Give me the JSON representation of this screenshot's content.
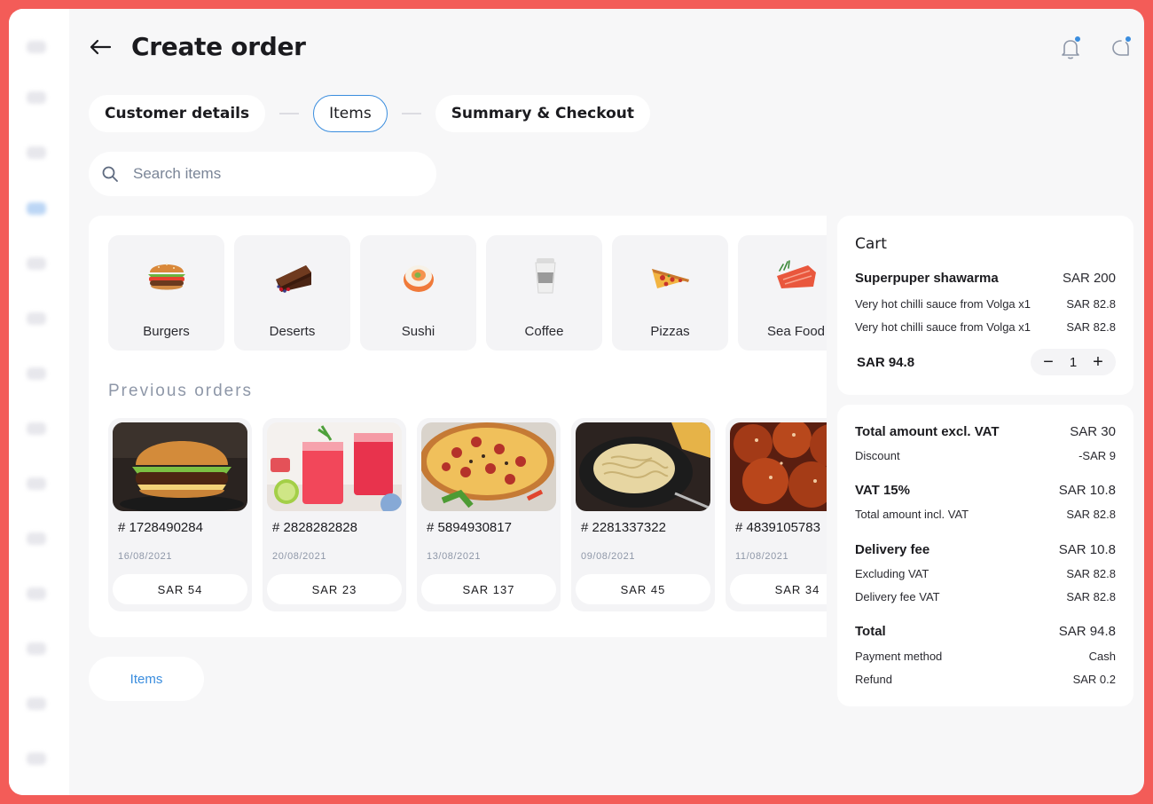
{
  "header": {
    "title": "Create order"
  },
  "steps": [
    {
      "label": "Customer details"
    },
    {
      "label": "Items"
    },
    {
      "label": "Summary & Checkout"
    }
  ],
  "search": {
    "placeholder": "Search items"
  },
  "categories": [
    {
      "label": "Burgers"
    },
    {
      "label": "Deserts"
    },
    {
      "label": "Sushi"
    },
    {
      "label": "Coffee"
    },
    {
      "label": "Pizzas"
    },
    {
      "label": "Sea Food"
    }
  ],
  "previous_orders": {
    "title": "Previous orders",
    "items": [
      {
        "number": "# 1728490284",
        "date": "16/08/2021",
        "price": "SAR 54"
      },
      {
        "number": "# 2828282828",
        "date": "20/08/2021",
        "price": "SAR 23"
      },
      {
        "number": "# 5894930817",
        "date": "13/08/2021",
        "price": "SAR 137"
      },
      {
        "number": "# 2281337322",
        "date": "09/08/2021",
        "price": "SAR 45"
      },
      {
        "number": "# 4839105783",
        "date": "11/08/2021",
        "price": "SAR 34"
      }
    ]
  },
  "items_button": "Items",
  "cart": {
    "title": "Cart",
    "item_name": "Superpuper shawarma",
    "item_price": "SAR 200",
    "extras": [
      {
        "label": "Very hot chilli sauce from Volga x1",
        "price": "SAR 82.8"
      },
      {
        "label": "Very hot chilli sauce from Volga x1",
        "price": "SAR 82.8"
      }
    ],
    "subtotal": "SAR 94.8",
    "quantity": "1",
    "minus": "−",
    "plus": "+"
  },
  "totals": {
    "excl_vat_label": "Total amount excl. VAT",
    "excl_vat_value": "SAR 30",
    "discount_label": "Discount",
    "discount_value": "-SAR 9",
    "vat_label": "VAT 15%",
    "vat_value": "SAR 10.8",
    "incl_vat_label": "Total amount incl. VAT",
    "incl_vat_value": "SAR 82.8",
    "delivery_label": "Delivery fee",
    "delivery_value": "SAR 10.8",
    "excluding_vat_label": "Excluding VAT",
    "excluding_vat_value": "SAR 82.8",
    "delivery_vat_label": "Delivery fee VAT",
    "delivery_vat_value": "SAR 82.8",
    "total_label": "Total",
    "total_value": "SAR 94.8",
    "payment_label": "Payment method",
    "payment_value": "Cash",
    "refund_label": "Refund",
    "refund_value": "SAR 0.2"
  },
  "colors": {
    "accent": "#3a8dde",
    "frame": "#f35c58",
    "background": "#f7f7f8"
  },
  "icons": {
    "back": "arrow-left-icon",
    "notifications": "bell-icon",
    "chat": "chat-icon",
    "search": "search-icon"
  }
}
